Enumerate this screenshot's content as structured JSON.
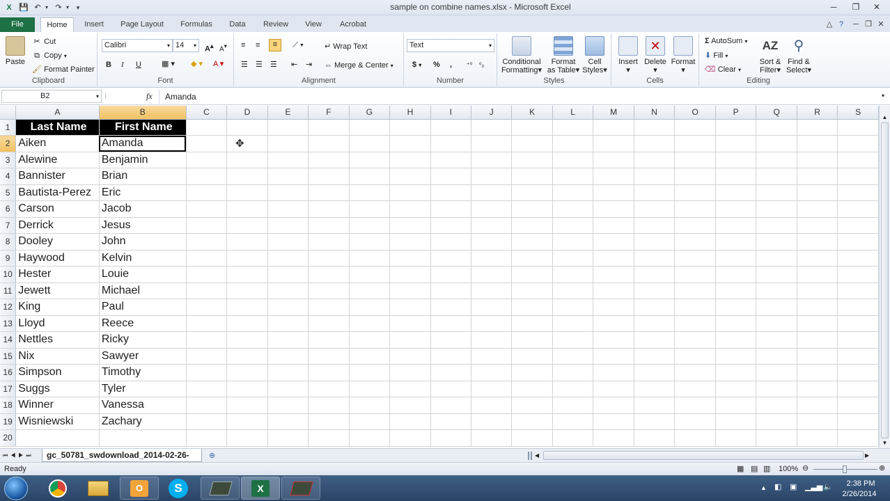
{
  "window": {
    "title": "sample on combine names.xlsx - Microsoft Excel",
    "minimize": "─",
    "restore": "❐",
    "close": "✕"
  },
  "quick_access": {
    "save_icon": "save-icon",
    "undo_icon": "undo-icon",
    "redo_icon": "redo-icon"
  },
  "tabs": [
    "File",
    "Home",
    "Insert",
    "Page Layout",
    "Formulas",
    "Data",
    "Review",
    "View",
    "Acrobat"
  ],
  "ribbon": {
    "clipboard": {
      "label": "Clipboard",
      "paste": "Paste",
      "cut": "Cut",
      "copy": "Copy",
      "format_painter": "Format Painter"
    },
    "font": {
      "label": "Font",
      "name": "Calibri",
      "size": "14",
      "bold": "B",
      "italic": "I",
      "underline": "U"
    },
    "alignment": {
      "label": "Alignment",
      "wrap_text": "Wrap Text",
      "merge_center": "Merge & Center"
    },
    "number": {
      "label": "Number",
      "format": "Text",
      "currency": "$",
      "percent": "%",
      "comma": ","
    },
    "styles": {
      "label": "Styles",
      "conditional": [
        "Conditional",
        "Formatting"
      ],
      "format_table": [
        "Format",
        "as Table"
      ],
      "cell_styles": [
        "Cell",
        "Styles"
      ]
    },
    "cells": {
      "label": "Cells",
      "insert": "Insert",
      "delete": "Delete",
      "format": "Format"
    },
    "editing": {
      "label": "Editing",
      "autosum": "AutoSum",
      "fill": "Fill",
      "clear": "Clear",
      "sort_filter": [
        "Sort &",
        "Filter"
      ],
      "find_select": [
        "Find &",
        "Select"
      ]
    }
  },
  "formula_bar": {
    "name_box": "B2",
    "fx": "fx",
    "value": "Amanda"
  },
  "columns": [
    "A",
    "B",
    "C",
    "D",
    "E",
    "F",
    "G",
    "H",
    "I",
    "J",
    "K",
    "L",
    "M",
    "N",
    "O",
    "P",
    "Q",
    "R",
    "S"
  ],
  "header_row": {
    "a": "Last Name",
    "b": "First Name"
  },
  "rows": [
    {
      "n": "1"
    },
    {
      "n": "2",
      "a": "Aiken",
      "b": "Amanda"
    },
    {
      "n": "3",
      "a": "Alewine",
      "b": "Benjamin"
    },
    {
      "n": "4",
      "a": "Bannister",
      "b": "Brian"
    },
    {
      "n": "5",
      "a": "Bautista-Perez",
      "b": "Eric"
    },
    {
      "n": "6",
      "a": "Carson",
      "b": "Jacob"
    },
    {
      "n": "7",
      "a": "Derrick",
      "b": "Jesus"
    },
    {
      "n": "8",
      "a": "Dooley",
      "b": "John"
    },
    {
      "n": "9",
      "a": "Haywood",
      "b": "Kelvin"
    },
    {
      "n": "10",
      "a": "Hester",
      "b": "Louie"
    },
    {
      "n": "11",
      "a": "Jewett",
      "b": "Michael"
    },
    {
      "n": "12",
      "a": "King",
      "b": "Paul"
    },
    {
      "n": "13",
      "a": "Lloyd",
      "b": "Reece"
    },
    {
      "n": "14",
      "a": "Nettles",
      "b": "Ricky"
    },
    {
      "n": "15",
      "a": "Nix",
      "b": "Sawyer"
    },
    {
      "n": "16",
      "a": "Simpson",
      "b": "Timothy"
    },
    {
      "n": "17",
      "a": "Suggs",
      "b": "Tyler"
    },
    {
      "n": "18",
      "a": "Winner",
      "b": "Vanessa"
    },
    {
      "n": "19",
      "a": "Wisniewski",
      "b": "Zachary"
    },
    {
      "n": "20"
    }
  ],
  "sheet_tab": "gc_50781_swdownload_2014-02-26-",
  "status": {
    "ready": "Ready",
    "zoom": "100%"
  },
  "taskbar": {
    "time": "2:38 PM",
    "date": "2/26/2014"
  },
  "colors": {
    "file_tab": "#1e7145",
    "header_fill": "#000000",
    "selected_header": "#f1c15f",
    "taskbar": "#2a4466"
  }
}
